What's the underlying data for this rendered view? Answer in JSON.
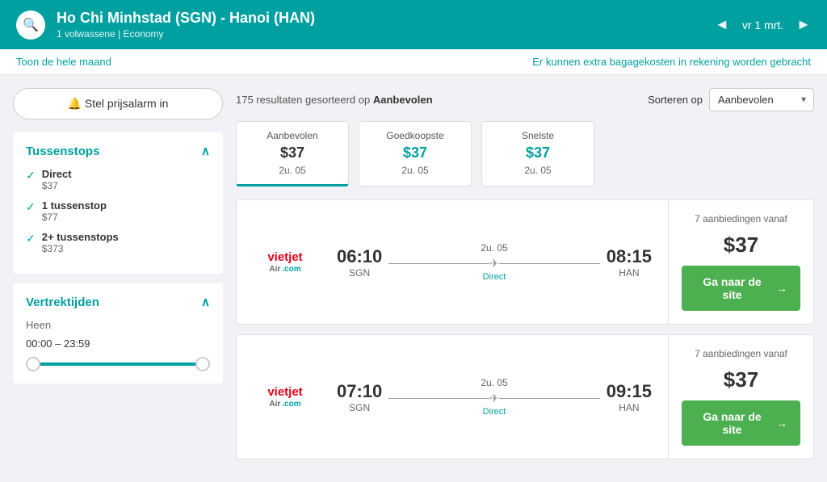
{
  "header": {
    "route": "Ho Chi Minhstad (SGN) - Hanoi (HAN)",
    "passengers": "1 volwassene",
    "cabin": "Economy",
    "date": "vr 1 mrt.",
    "prev_arrow": "◄",
    "next_arrow": "►"
  },
  "subheader": {
    "show_month": "Toon de hele maand",
    "baggage_notice": "Er kunnen extra bagagekosten in rekening worden gebracht"
  },
  "alarm_button": "🔔 Stel prijsalarm in",
  "filters": {
    "tussenstops_label": "Tussenstops",
    "stops": [
      {
        "label": "Direct",
        "price": "$37",
        "checked": true
      },
      {
        "label": "1 tussenstop",
        "price": "$77",
        "checked": true
      },
      {
        "label": "2+ tussenstops",
        "price": "$373",
        "checked": true
      }
    ],
    "vertrektijden_label": "Vertrektijden",
    "heen_label": "Heen",
    "time_range": "00:00 – 23:59"
  },
  "toolbar": {
    "results_prefix": "175 resultaten gesorteerd op ",
    "results_sort": "Aanbevolen",
    "sort_label": "Sorteren op",
    "sort_value": "Aanbevolen"
  },
  "tabs": [
    {
      "label": "Aanbevolen",
      "price": "$37",
      "duration": "2u. 05",
      "active": true
    },
    {
      "label": "Goedkoopste",
      "price": "$37",
      "duration": "2u. 05",
      "active": false
    },
    {
      "label": "Snelste",
      "price": "$37",
      "duration": "2u. 05",
      "active": false
    }
  ],
  "flights": [
    {
      "airline": "VietJet Air",
      "dep_time": "06:10",
      "dep_airport": "SGN",
      "duration": "2u. 05",
      "arr_time": "08:15",
      "arr_airport": "HAN",
      "direct": "Direct",
      "offers": "7 aanbiedingen vanaf",
      "price": "$37",
      "btn_label": "Ga naar de site",
      "btn_arrow": "→"
    },
    {
      "airline": "VietJet Air",
      "dep_time": "07:10",
      "dep_airport": "SGN",
      "duration": "2u. 05",
      "arr_time": "09:15",
      "arr_airport": "HAN",
      "direct": "Direct",
      "offers": "7 aanbiedingen vanaf",
      "price": "$37",
      "btn_label": "Ga naar de site",
      "btn_arrow": "→"
    }
  ],
  "colors": {
    "teal": "#00a0a0",
    "green": "#4caf50",
    "red": "#e8001b"
  }
}
